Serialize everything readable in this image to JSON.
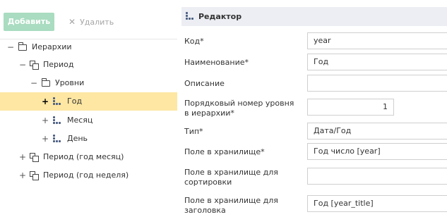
{
  "toolbar": {
    "add_label": "Добавить",
    "delete_label": "Удалить",
    "delete_icon": "close-icon"
  },
  "tree": {
    "items": [
      {
        "label": "Иерархии",
        "toggle": "−",
        "icon": "folder-icon"
      },
      {
        "label": "Период",
        "toggle": "−",
        "icon": "hierarchy-icon"
      },
      {
        "label": "Уровни",
        "toggle": "−",
        "icon": "folder-icon"
      },
      {
        "label": "Год",
        "toggle": "+",
        "icon": "level-icon",
        "selected": true
      },
      {
        "label": "Месяц",
        "toggle": "+",
        "icon": "level-icon"
      },
      {
        "label": "День",
        "toggle": "+",
        "icon": "level-icon"
      },
      {
        "label": "Период (год месяц)",
        "toggle": "+",
        "icon": "hierarchy-icon"
      },
      {
        "label": "Период (год неделя)",
        "toggle": "+",
        "icon": "hierarchy-icon"
      }
    ],
    "selected_color": "#fde7a3"
  },
  "editor": {
    "title": "Редактор",
    "fields": {
      "code": {
        "label": "Код*",
        "value": "year"
      },
      "name": {
        "label": "Наименование*",
        "value": "Год"
      },
      "description": {
        "label": "Описание",
        "value": ""
      },
      "order": {
        "label": "Порядковый номер уровня в иерархии*",
        "value": "1"
      },
      "type": {
        "label": "Тип*",
        "value": "Дата/Год"
      },
      "storage_field": {
        "label": "Поле в хранилище*",
        "value": "Год число [year]"
      },
      "sort_field": {
        "label": "Поле в хранилище для сортировки",
        "value": ""
      },
      "title_field": {
        "label": "Поле в хранилище для заголовка",
        "value": "Год [year_title]"
      }
    }
  },
  "colors": {
    "add_button": "#a9dcc0",
    "header_bg": "#eceef3",
    "level_icon": "#4a5d80"
  }
}
